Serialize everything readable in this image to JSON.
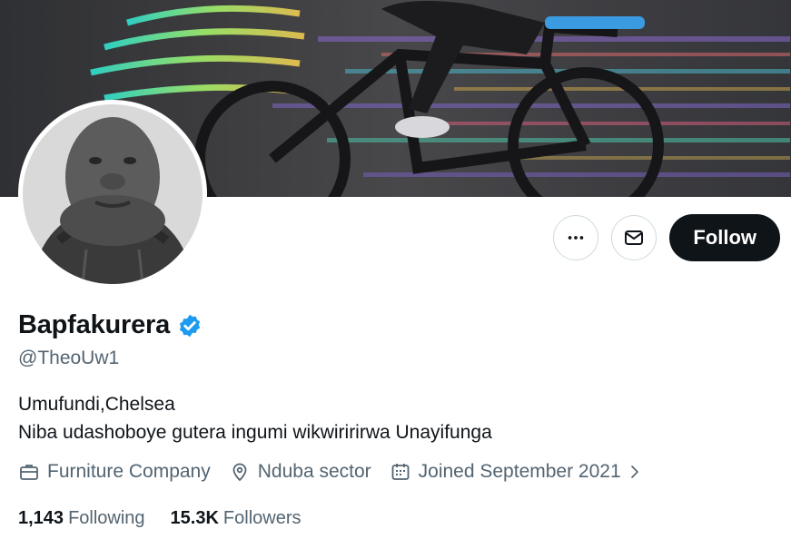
{
  "profile": {
    "name": "Bapfakurera",
    "handle": "@TheoUw1",
    "bio_lines": [
      "Umufundi,Chelsea",
      "Niba udashoboye gutera ingumi wikwiririrwa Unayifunga"
    ],
    "verified": true
  },
  "meta": {
    "category": "Furniture Company",
    "location": "Nduba sector",
    "joined": "Joined September 2021"
  },
  "stats": {
    "following_count": "1,143",
    "following_label": "Following",
    "followers_count": "15.3K",
    "followers_label": "Followers"
  },
  "actions": {
    "follow_label": "Follow"
  },
  "icons": [
    "more-icon",
    "mail-icon",
    "verified-badge-icon",
    "briefcase-icon",
    "location-pin-icon",
    "calendar-icon",
    "chevron-right-icon"
  ],
  "colors": {
    "accent": "#1d9bf0",
    "primary_text": "#0f1419",
    "secondary_text": "#536471",
    "button": "#0f1419"
  }
}
